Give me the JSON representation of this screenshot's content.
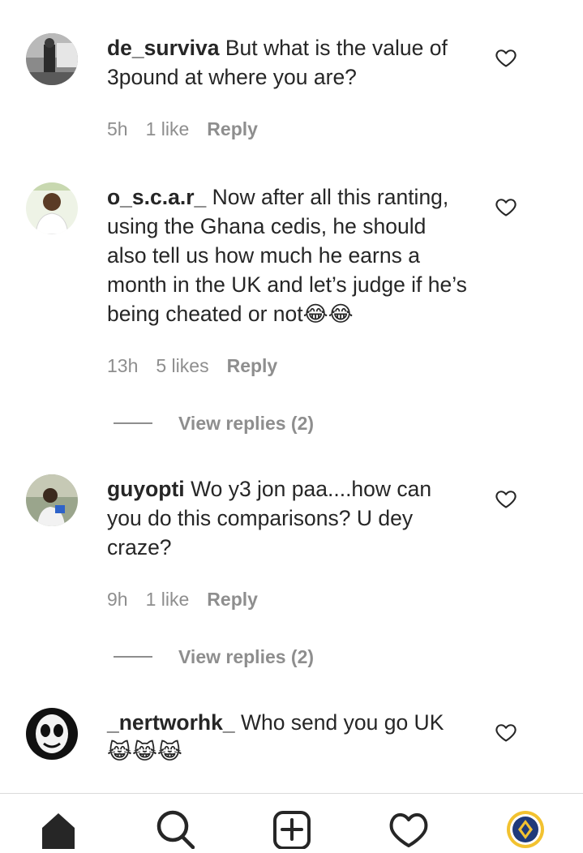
{
  "comments": [
    {
      "username": "de_surviva",
      "text": "But what is the value of 3pound at where you are?",
      "time": "5h",
      "likes": "1 like",
      "reply": "Reply"
    },
    {
      "username": "o_s.c.a.r_",
      "text": "Now after all this ranting, using the Ghana cedis, he should also tell us how much he earns a month in the UK and let’s judge if he’s being cheated or not😂😂",
      "time": "13h",
      "likes": "5 likes",
      "reply": "Reply",
      "view_replies": "View replies (2)"
    },
    {
      "username": "guyopti",
      "text": "Wo y3 jon paa....how can you do this comparisons? U dey craze?",
      "time": "9h",
      "likes": "1 like",
      "reply": "Reply",
      "view_replies": "View replies (2)"
    },
    {
      "username": "_nertworhk_",
      "text": "Who send you go UK 😹😹😹"
    }
  ],
  "nav": {
    "items": [
      "home-icon",
      "search-icon",
      "new-post-icon",
      "activity-heart-icon",
      "profile-avatar"
    ]
  },
  "colors": {
    "text": "#262626",
    "secondary": "#8e8e8e",
    "divider": "#dbdbdb",
    "profile_ring": "#f2c230",
    "profile_badge": "#1f3a7a"
  }
}
